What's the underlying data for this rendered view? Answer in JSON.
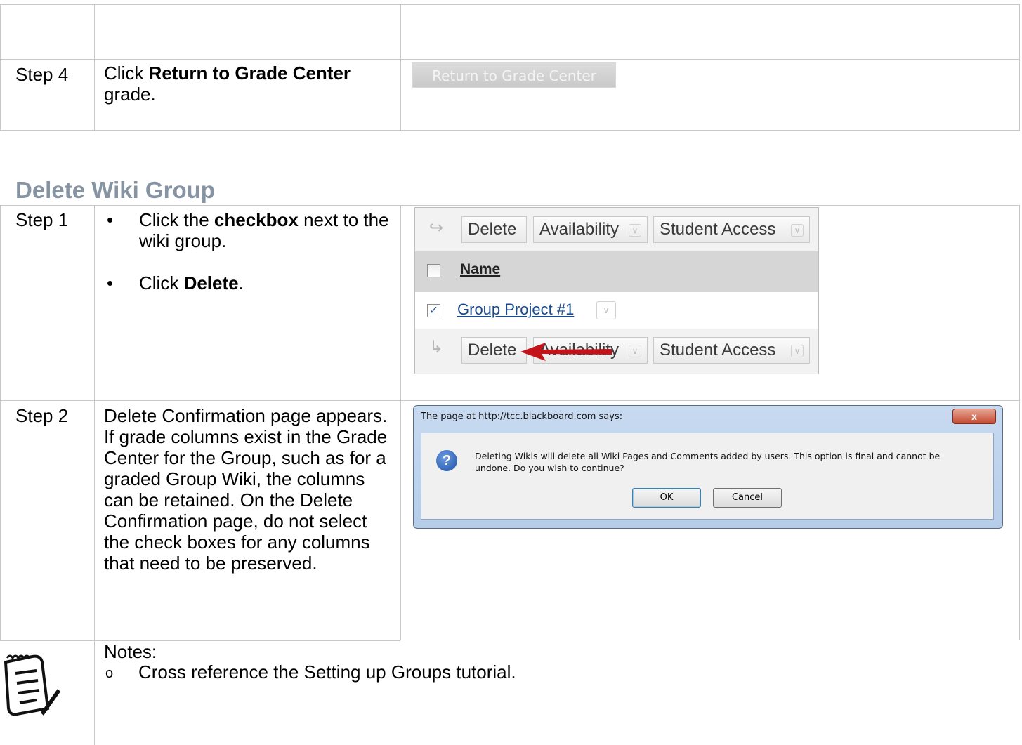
{
  "table": {
    "rows": [
      {
        "step": "Step 4",
        "text_bold": "Return to Grade Center",
        "text_prefix": "Click ",
        "text_suffix": "grade."
      },
      {
        "step": "Step 1"
      },
      {
        "step": "Step 2",
        "text": "Delete Confirmation page appears. If grade columns exist in the Grade Center for the Group, such as for a graded Group Wiki, the columns can be retained. On the Delete Confirmation page, do not select the check boxes for any columns that need to be preserved."
      }
    ],
    "section_heading": "Delete Wiki Group",
    "step1_bullets": [
      {
        "prefix": "Click the ",
        "bold": "checkbox",
        "suffix": " next to the wiki group."
      },
      {
        "prefix": "Click ",
        "bold": "Delete",
        "suffix": "."
      }
    ],
    "notes_label": "Notes:",
    "notes_item": "Cross reference the Setting up Groups tutorial.",
    "notes_marker": "o"
  },
  "return_button": {
    "label": "Return to Grade Center"
  },
  "wiki_list": {
    "delete_label": "Delete",
    "availability_label": "Availability",
    "student_access_label": "Student Access",
    "name_header": "Name",
    "group_name": "Group Project #1"
  },
  "dialog": {
    "title": "The page at http://tcc.blackboard.com says:",
    "close_label": "x",
    "message": "Deleting Wikis will delete all Wiki Pages and Comments added by users. This option is final and cannot be undone. Do you wish to continue?",
    "ok_label": "OK",
    "cancel_label": "Cancel"
  },
  "colors": {
    "heading": "#8593a2",
    "arrow": "#c2121a",
    "border": "#c8c8c8",
    "link": "#1a4a8a"
  },
  "icons": [
    "notepad-icon",
    "question-icon",
    "close-icon",
    "arrow-icon",
    "chevron-down-icon"
  ]
}
